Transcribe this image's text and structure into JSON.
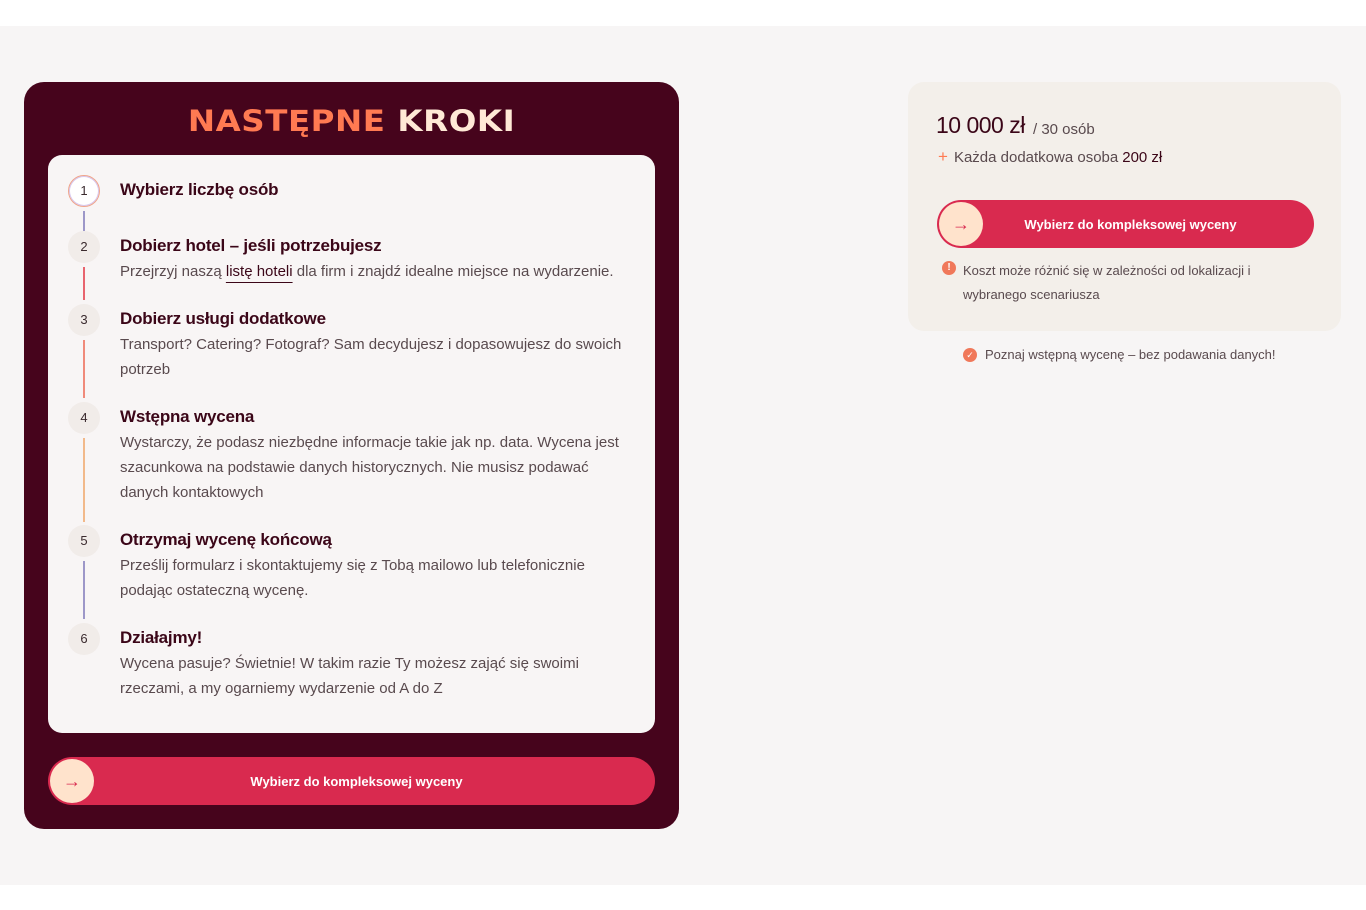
{
  "steps_panel": {
    "title_part1": "NASTĘPNE",
    "title_part2": "KROKI",
    "steps": [
      {
        "num": "1",
        "title": "Wybierz liczbę osób",
        "text": ""
      },
      {
        "num": "2",
        "title": "Dobierz hotel – jeśli potrzebujesz",
        "text_before": "Przejrzyj naszą ",
        "link": "listę hoteli",
        "text_after": " dla firm i znajdź idealne miejsce na wydarzenie."
      },
      {
        "num": "3",
        "title": "Dobierz usługi dodatkowe",
        "text": "Transport? Catering? Fotograf? Sam decydujesz i dopasowujesz do swoich potrzeb"
      },
      {
        "num": "4",
        "title": "Wstępna wycena",
        "text": "Wystarczy, że podasz niezbędne informacje takie jak np. data. Wycena jest szacunkowa na podstawie danych historycznych. Nie musisz podawać danych kontaktowych"
      },
      {
        "num": "5",
        "title": "Otrzymaj wycenę końcową",
        "text": "Prześlij formularz i skontaktujemy się z Tobą mailowo lub telefonicznie podając ostateczną wycenę."
      },
      {
        "num": "6",
        "title": "Działajmy!",
        "text": "Wycena pasuje? Świetnie! W takim razie Ty możesz zająć się swoimi rzeczami, a my ogarniemy wydarzenie od A do Z"
      }
    ],
    "cta_label": "Wybierz do kompleksowej wyceny"
  },
  "price_panel": {
    "price": "10 000 zł",
    "per": "/ 30 osób",
    "extra_label": "Każda dodatkowa osoba",
    "extra_value": "200 zł",
    "cta_label": "Wybierz do kompleksowej wyceny",
    "info_note": "Koszt może różnić się w zależności od lokalizacji i wybranego scenariusza"
  },
  "check_note": "Poznaj wstępną wycenę – bez podawania danych!",
  "colors": {
    "panel_dark": "#46041c",
    "accent": "#d92a4f",
    "orange": "#ff7a52",
    "cream": "#ffe3cc"
  },
  "icons": [
    "arrow-right-icon",
    "plus-icon",
    "info-icon",
    "check-badge-icon"
  ]
}
